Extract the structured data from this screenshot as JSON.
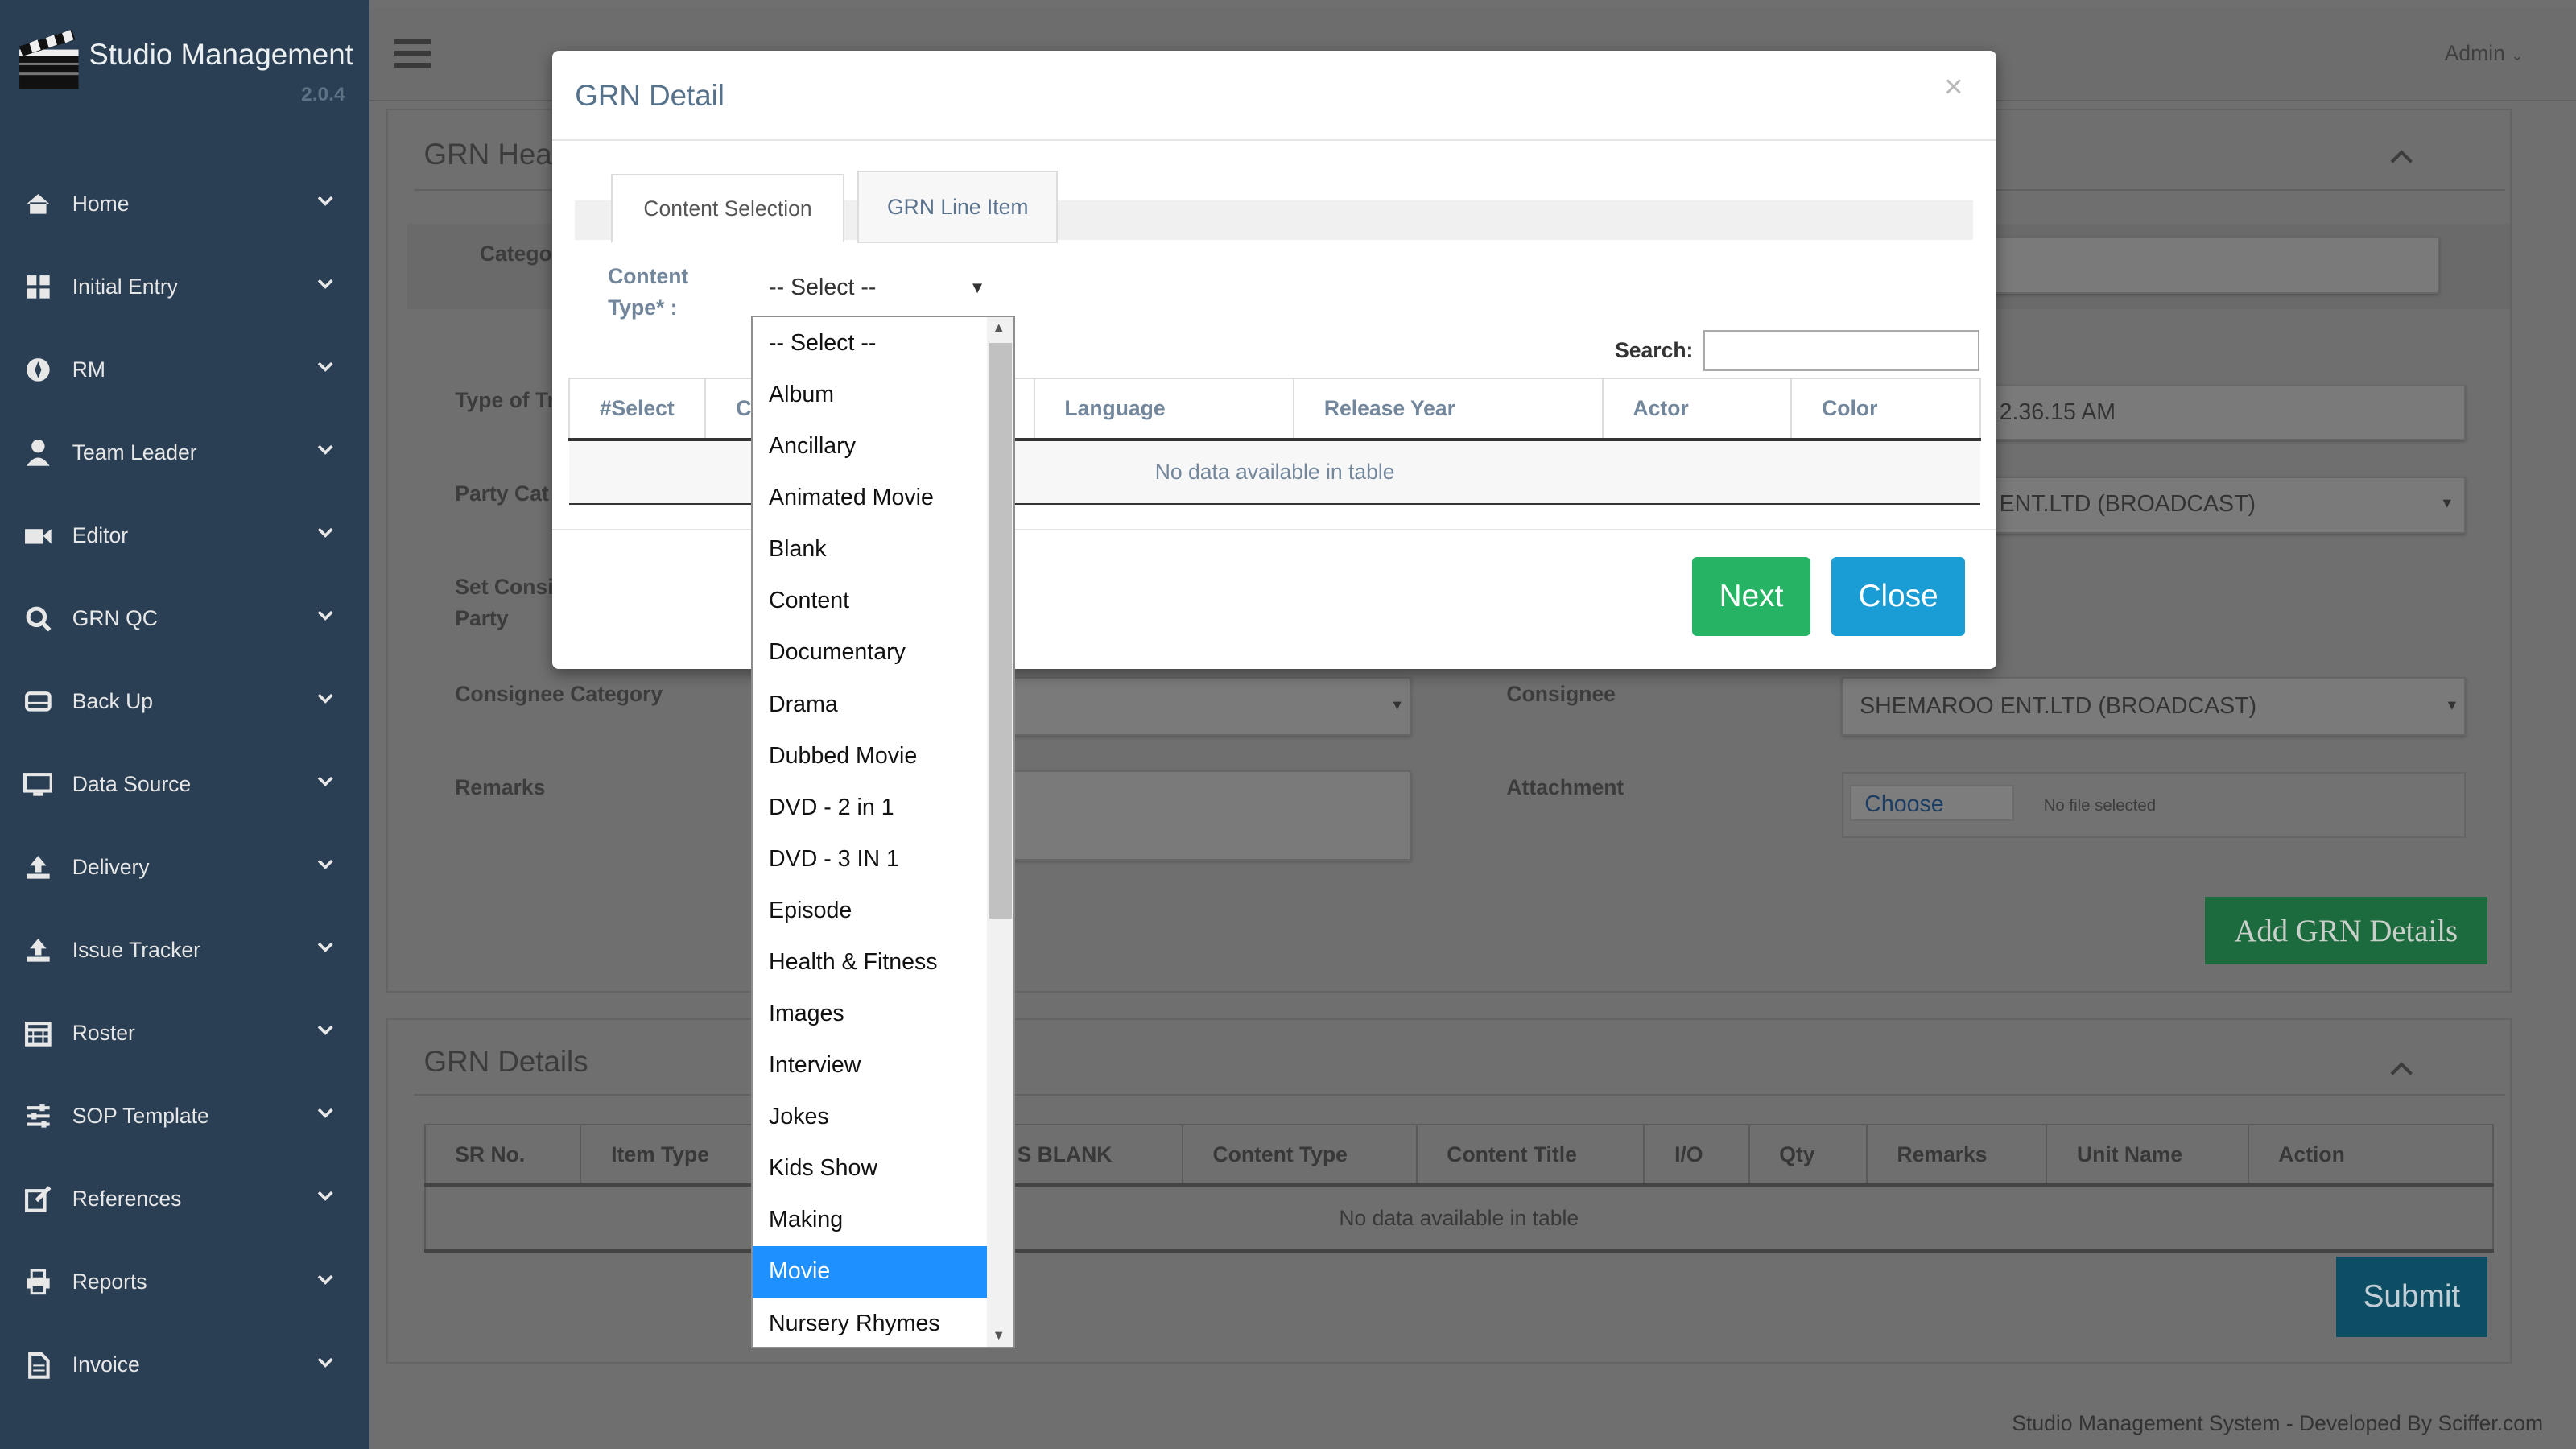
{
  "app": {
    "name": "Studio Management",
    "version": "2.0.4",
    "user": "Admin"
  },
  "sidebar": {
    "items": [
      {
        "label": "Home",
        "icon": "home-icon"
      },
      {
        "label": "Initial Entry",
        "icon": "grid-icon"
      },
      {
        "label": "RM",
        "icon": "compass-icon"
      },
      {
        "label": "Team Leader",
        "icon": "user-icon"
      },
      {
        "label": "Editor",
        "icon": "video-camera-icon"
      },
      {
        "label": "GRN QC",
        "icon": "search-icon"
      },
      {
        "label": "Back Up",
        "icon": "hard-drive-icon"
      },
      {
        "label": "Data Source",
        "icon": "monitor-icon"
      },
      {
        "label": "Delivery",
        "icon": "upload-icon"
      },
      {
        "label": "Issue Tracker",
        "icon": "upload-icon"
      },
      {
        "label": "Roster",
        "icon": "calendar-icon"
      },
      {
        "label": "SOP Template",
        "icon": "sliders-icon"
      },
      {
        "label": "References",
        "icon": "edit-icon"
      },
      {
        "label": "Reports",
        "icon": "print-icon"
      },
      {
        "label": "Invoice",
        "icon": "file-icon"
      }
    ]
  },
  "header_panel": {
    "title": "GRN Hea",
    "category_label": "Catego",
    "type_label": "Type of Tr",
    "type_value": "2.36.15 AM",
    "party_label": "Party Cat",
    "party_value": "ENT.LTD (BROADCAST)",
    "set_consignee_label_1": "Set Consi",
    "set_consignee_label_2": "Party",
    "consignee_category_label": "Consignee Category",
    "consignee_label": "Consignee",
    "consignee_value": "SHEMAROO ENT.LTD (BROADCAST)",
    "remarks_label": "Remarks",
    "attachment_label": "Attachment",
    "choose_label": "Choose",
    "no_file": "No file selected",
    "add_button": "Add GRN Details"
  },
  "details_panel": {
    "title": "GRN Details",
    "columns": [
      "SR No.",
      "Item Type",
      "",
      "S BLANK",
      "Content Type",
      "Content Title",
      "I/O",
      "Qty",
      "Remarks",
      "Unit Name",
      "Action"
    ],
    "empty": "No data available in table",
    "submit": "Submit"
  },
  "footer": "Studio Management System - Developed By Sciffer.com",
  "modal": {
    "title": "GRN Detail",
    "close_x": "×",
    "tabs": [
      {
        "label": "Content Selection",
        "active": true
      },
      {
        "label": "GRN Line Item",
        "active": false
      }
    ],
    "content_type_label_1": "Content",
    "content_type_label_2": "Type* :",
    "selected_value": "-- Select --",
    "search_label": "Search:",
    "columns": [
      "#Select",
      "C",
      "Language",
      "Release Year",
      "Actor",
      "Color"
    ],
    "empty": "No data available in table",
    "next": "Next",
    "close": "Close"
  },
  "dropdown": {
    "options": [
      "-- Select --",
      "Album",
      "Ancillary",
      "Animated Movie",
      "Blank",
      "Content",
      "Documentary",
      "Drama",
      "Dubbed Movie",
      "DVD - 2 in 1",
      "DVD - 3 IN 1",
      "Episode",
      "Health & Fitness",
      "Images",
      "Interview",
      "Jokes",
      "Kids Show",
      "Making",
      "Movie",
      "Nursery Rhymes"
    ],
    "highlighted": "Movie"
  }
}
